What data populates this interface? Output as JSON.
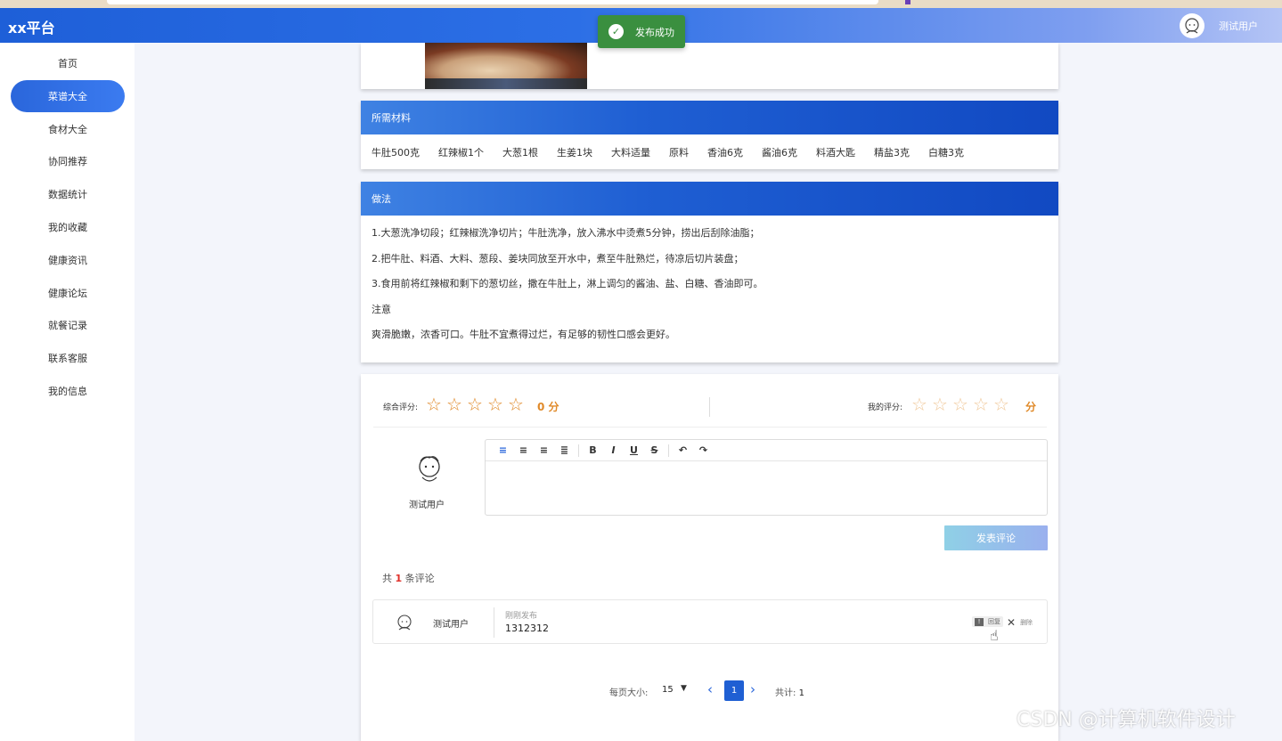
{
  "app": {
    "brand": "xx平台",
    "user_name": "测试用户"
  },
  "toast": {
    "message": "发布成功"
  },
  "sidebar": {
    "items": [
      {
        "label": "首页",
        "active": false
      },
      {
        "label": "菜谱大全",
        "active": true
      },
      {
        "label": "食材大全",
        "active": false
      },
      {
        "label": "协同推荐",
        "active": false
      },
      {
        "label": "数据统计",
        "active": false
      },
      {
        "label": "我的收藏",
        "active": false
      },
      {
        "label": "健康资讯",
        "active": false
      },
      {
        "label": "健康论坛",
        "active": false
      },
      {
        "label": "就餐记录",
        "active": false
      },
      {
        "label": "联系客服",
        "active": false
      },
      {
        "label": "我的信息",
        "active": false
      }
    ]
  },
  "ingredients": {
    "title": "所需材料",
    "items": [
      "牛肚500克",
      "红辣椒1个",
      "大葱1根",
      "生姜1块",
      "大料适量",
      "原料",
      "香油6克",
      "酱油6克",
      "料酒大匙",
      "精盐3克",
      "白糖3克"
    ]
  },
  "method": {
    "title": "做法",
    "steps": [
      "1.大葱洗净切段；红辣椒洗净切片；牛肚洗净，放入沸水中烫煮5分钟，捞出后刮除油脂；",
      "2.把牛肚、料酒、大料、葱段、姜块同放至开水中，煮至牛肚熟烂，待凉后切片装盘；",
      "3.食用前将红辣椒和剩下的葱切丝，撒在牛肚上，淋上调匀的酱油、盐、白糖、香油即可。",
      "注意",
      "爽滑脆嫩，浓香可口。牛肚不宜煮得过烂，有足够的韧性口感会更好。"
    ]
  },
  "rating": {
    "overall_label": "综合评分:",
    "overall_score": "0 分",
    "overall_stars": 0,
    "my_label": "我的评分:",
    "my_score": "分",
    "my_stars": 0
  },
  "editor": {
    "commenter_name": "测试用户",
    "submit_label": "发表评论",
    "toolbar": [
      "align-left-icon",
      "align-center-icon",
      "align-right-icon",
      "align-justify-icon",
      "bold-icon",
      "italic-icon",
      "underline-icon",
      "strikethrough-icon",
      "undo-icon",
      "redo-icon"
    ]
  },
  "comments": {
    "count_prefix": "共",
    "count": "1",
    "count_suffix": "条评论",
    "items": [
      {
        "name": "测试用户",
        "time": "刚刚发布",
        "text": "1312312",
        "reply_label": "回复",
        "delete_label": "删除"
      }
    ]
  },
  "pagination": {
    "page_size_label": "每页大小:",
    "page_size": "15",
    "current_page": "1",
    "total_label": "共计:",
    "total": "1"
  },
  "watermark": "CSDN @计算机软件设计"
}
